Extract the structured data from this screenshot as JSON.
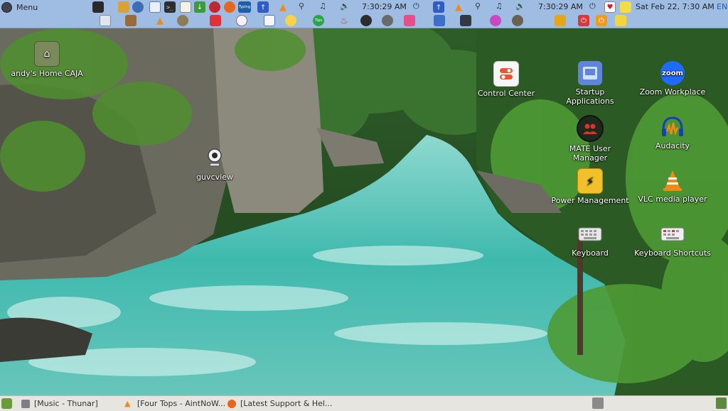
{
  "panel_top": {
    "menu_label": "Menu",
    "clock1": "7:30:29 AM",
    "clock2": "7:30:29 AM",
    "date_time": "Sat Feb 22, 7:30 AM",
    "keyboard_layout": "EN",
    "typing_label": "Typing",
    "zoom_label": "zoom"
  },
  "desktop": {
    "home_label": "andy's Home CAJA",
    "guvcview_label": "guvcview",
    "control_center_label": "Control Center",
    "startup_label": "Startup Applications",
    "zoom_label": "Zoom Workplace",
    "mate_user_label": "MATE User Manager",
    "audacity_label": "Audacity",
    "power_label": "Power Management",
    "vlc_label": "VLC media player",
    "keyboard_label": "Keyboard",
    "keyboard_shortcuts_label": "Keyboard Shortcuts"
  },
  "taskbar": {
    "task1": "[Music - Thunar]",
    "task2": "[Four Tops - AintNoW...",
    "task3": "[Latest Support & Hel..."
  },
  "colors": {
    "panel_bg": "#9fbce2",
    "taskbar_bg": "#e7e5df",
    "river": "#3fb9ad"
  }
}
